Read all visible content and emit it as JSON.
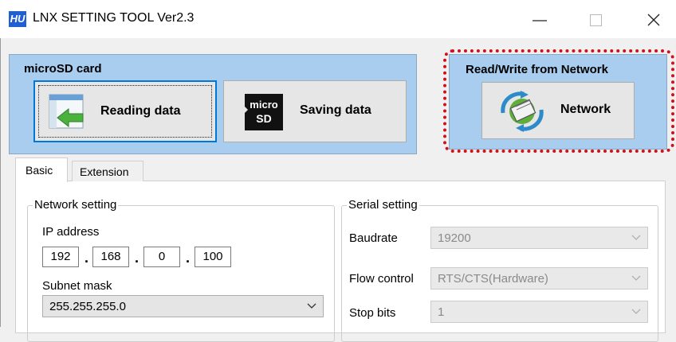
{
  "window": {
    "icon_text": "HU",
    "title": "LNX SETTING TOOL Ver2.3"
  },
  "microsd": {
    "title": "microSD card",
    "reading_label": "Reading data",
    "saving_label": "Saving data",
    "sd_logo_top": "micro",
    "sd_logo_bottom": "SD"
  },
  "network_panel": {
    "title": "Read/Write from Network",
    "button_label": "Network"
  },
  "tabs": [
    {
      "label": "Basic",
      "active": true
    },
    {
      "label": "Extension",
      "active": false
    }
  ],
  "network_setting": {
    "title": "Network setting",
    "ip_label": "IP address",
    "ip_octets": [
      "192",
      "168",
      "0",
      "100"
    ],
    "subnet_label": "Subnet mask",
    "subnet_value": "255.255.255.0"
  },
  "serial_setting": {
    "title": "Serial setting",
    "baudrate_label": "Baudrate",
    "baudrate_value": "19200",
    "flow_label": "Flow control",
    "flow_value": "RTS/CTS(Hardware)",
    "stopbits_label": "Stop bits",
    "stopbits_value": "1"
  },
  "colors": {
    "panel_bg": "#a9cdee",
    "highlight": "#d0101a",
    "focus_border": "#0078d7"
  }
}
